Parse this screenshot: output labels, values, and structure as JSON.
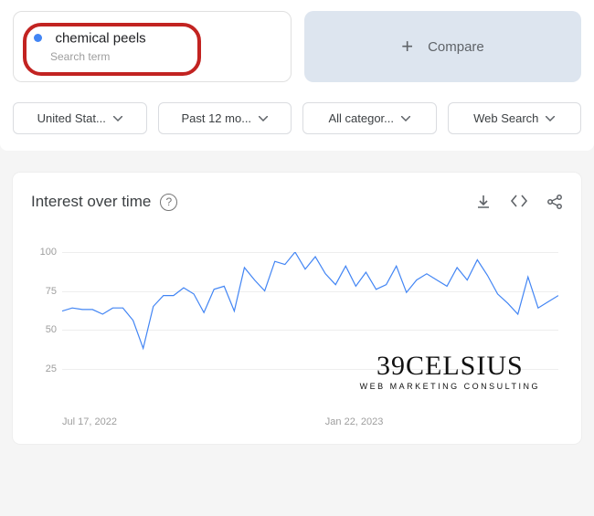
{
  "term_card": {
    "name": "chemical peels",
    "subtype": "Search term"
  },
  "compare": {
    "label": "Compare"
  },
  "filters": {
    "region": "United Stat...",
    "period": "Past 12 mo...",
    "category": "All categor...",
    "type": "Web Search"
  },
  "chart": {
    "title": "Interest over time"
  },
  "watermark": {
    "main": "39CELSIUS",
    "sub": "WEB MARKETING CONSULTING"
  },
  "chart_data": {
    "type": "line",
    "title": "Interest over time",
    "ylabel": "",
    "xlabel": "",
    "ylim": [
      0,
      100
    ],
    "y_ticks": [
      25,
      50,
      75,
      100
    ],
    "x_tick_labels": [
      "Jul 17, 2022",
      "Jan 22, 2023"
    ],
    "x_tick_positions": [
      0,
      0.53
    ],
    "series": [
      {
        "name": "chemical peels",
        "color": "#4285f4",
        "values": [
          62,
          64,
          63,
          63,
          60,
          64,
          64,
          56,
          38,
          65,
          72,
          72,
          77,
          73,
          61,
          76,
          78,
          62,
          90,
          82,
          75,
          94,
          92,
          100,
          89,
          97,
          86,
          79,
          91,
          78,
          87,
          76,
          79,
          91,
          74,
          82,
          86,
          82,
          78,
          90,
          82,
          95,
          85,
          73,
          67,
          60,
          84,
          64,
          68,
          72
        ]
      }
    ]
  }
}
